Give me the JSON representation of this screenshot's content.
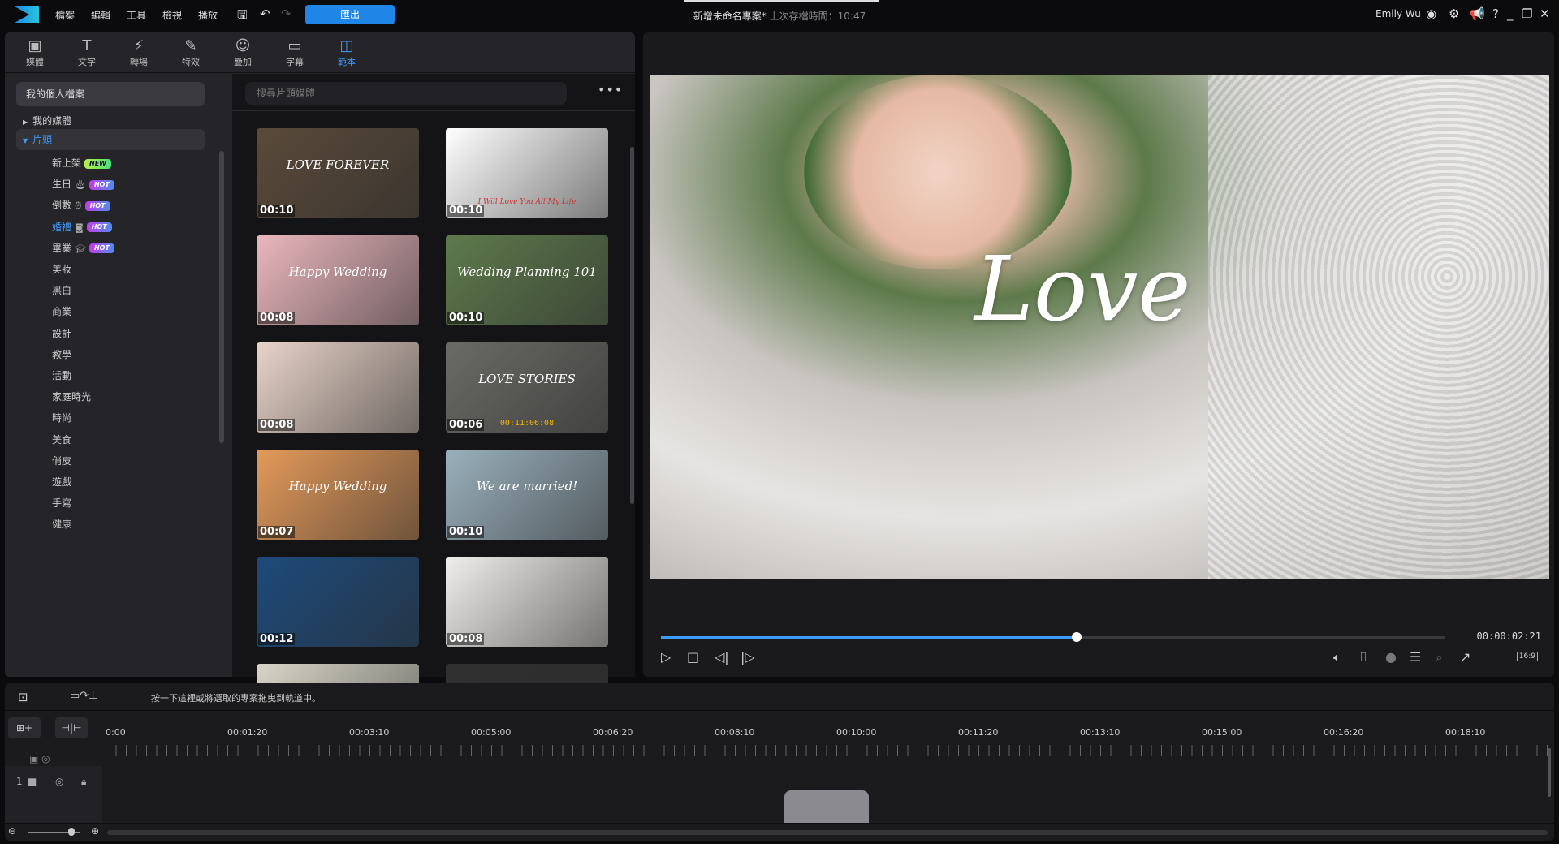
{
  "menu": {
    "items": [
      "檔案",
      "編輯",
      "工具",
      "檢視",
      "播放"
    ],
    "export_label": "匯出"
  },
  "project": {
    "title": "新增未命名專案*",
    "last_saved": "上次存檔時間：10:47"
  },
  "user": {
    "name": "Emily Wu"
  },
  "tabs": [
    {
      "label": "媒體",
      "icon": "media-icon"
    },
    {
      "label": "文字",
      "icon": "text-icon"
    },
    {
      "label": "轉場",
      "icon": "transition-icon"
    },
    {
      "label": "特效",
      "icon": "effect-icon"
    },
    {
      "label": "疊加",
      "icon": "overlay-icon"
    },
    {
      "label": "字幕",
      "icon": "subtitle-icon"
    },
    {
      "label": "範本",
      "icon": "template-icon",
      "active": true
    }
  ],
  "sidebar": {
    "profile": "我的個人檔案",
    "my_media": "我的媒體",
    "intro": "片頭",
    "categories": [
      {
        "label": "新上架",
        "badge": "NEW"
      },
      {
        "label": "生日",
        "badge": "HOT"
      },
      {
        "label": "倒數",
        "badge": "HOT"
      },
      {
        "label": "婚禮",
        "badge": "HOT",
        "active": true
      },
      {
        "label": "畢業",
        "badge": "HOT"
      },
      {
        "label": "美妝"
      },
      {
        "label": "黑白"
      },
      {
        "label": "商業"
      },
      {
        "label": "設計"
      },
      {
        "label": "教學"
      },
      {
        "label": "活動"
      },
      {
        "label": "家庭時光"
      },
      {
        "label": "時尚"
      },
      {
        "label": "美食"
      },
      {
        "label": "俏皮"
      },
      {
        "label": "遊戲"
      },
      {
        "label": "手寫"
      },
      {
        "label": "健康"
      }
    ]
  },
  "media": {
    "search_placeholder": "搜尋片頭媒體",
    "templates": [
      {
        "duration": "00:10",
        "caption": "LOVE FOREVER",
        "bg": "#5a4a3a"
      },
      {
        "duration": "00:10",
        "caption": "I Will Love You All My Life",
        "bg": "#ffffff"
      },
      {
        "duration": "00:08",
        "caption": "Happy Wedding",
        "bg": "#eab7bd"
      },
      {
        "duration": "00:10",
        "caption": "Wedding Planning 101",
        "bg": "#5e7a4c"
      },
      {
        "duration": "00:08",
        "caption": "",
        "bg": "#e8d3c8"
      },
      {
        "duration": "00:06",
        "caption": "LOVE STORIES",
        "bg": "#6a6a66",
        "timecode": "00:11:06:08"
      },
      {
        "duration": "00:07",
        "caption": "Happy Wedding",
        "bg": "#e49a5a"
      },
      {
        "duration": "00:10",
        "caption": "We are married!",
        "bg": "#9ab0bc"
      },
      {
        "duration": "00:12",
        "caption": "",
        "bg": "#1d4a7a"
      },
      {
        "duration": "00:08",
        "caption": "",
        "bg": "#f0eeec"
      },
      {
        "duration": "",
        "caption": "",
        "bg": "#d8d6c8"
      },
      {
        "duration": "",
        "caption": "",
        "bg": "#303030"
      }
    ]
  },
  "preview": {
    "overlay_text": "Love",
    "timecode": "00:00:02:21",
    "progress": 0.53,
    "aspect": "16:9"
  },
  "timeline": {
    "hint": "按一下這裡或將選取的專案拖曳到軌道中。",
    "track_number": "1",
    "ruler": [
      "0:00",
      "00:01:20",
      "00:03:10",
      "00:05:00",
      "00:06:20",
      "00:08:10",
      "00:10:00",
      "00:11:20",
      "00:13:10",
      "00:15:00",
      "00:16:20",
      "00:18:10"
    ]
  }
}
